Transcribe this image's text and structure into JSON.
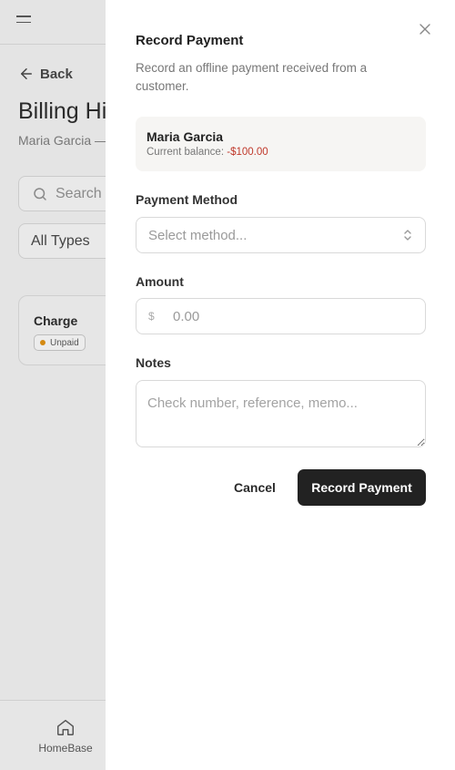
{
  "background": {
    "back_label": "Back",
    "title": "Billing Hi",
    "subtitle": "Maria Garcia —",
    "search_placeholder": "Search",
    "filter_value": "All Types",
    "card": {
      "title": "Charge",
      "badge": "Unpaid"
    },
    "bottom_nav": {
      "home_label": "HomeBase"
    }
  },
  "drawer": {
    "title": "Record Payment",
    "description": "Record an offline payment received from a customer.",
    "customer": {
      "name": "Maria Garcia",
      "balance_label": "Current balance:",
      "balance_value": "-$100.00"
    },
    "payment_method": {
      "label": "Payment Method",
      "placeholder": "Select method..."
    },
    "amount": {
      "label": "Amount",
      "currency": "$",
      "placeholder": "0.00"
    },
    "notes": {
      "label": "Notes",
      "placeholder": "Check number, reference, memo..."
    },
    "cancel_label": "Cancel",
    "submit_label": "Record Payment"
  },
  "colors": {
    "accent_dark": "#222222",
    "negative": "#c0392b",
    "unpaid_dot": "#d48a12"
  }
}
